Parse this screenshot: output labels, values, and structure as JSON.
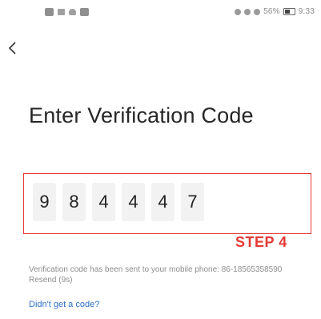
{
  "status_bar": {
    "right_text": "56%",
    "time": "9:33"
  },
  "screen": {
    "title": "Enter Verification Code",
    "code_digits": [
      "9",
      "8",
      "4",
      "4",
      "4",
      "7"
    ],
    "step_label": "STEP 4",
    "info_text": "Verification code has been sent to your mobile phone: 86-18565358590",
    "resend_label": "Resend (9s)",
    "no_code_link": "Didn't get a code?"
  },
  "colors": {
    "annotation_red": "#e53935",
    "link_blue": "#2f72c9",
    "cell_bg": "#f2f2f2"
  }
}
